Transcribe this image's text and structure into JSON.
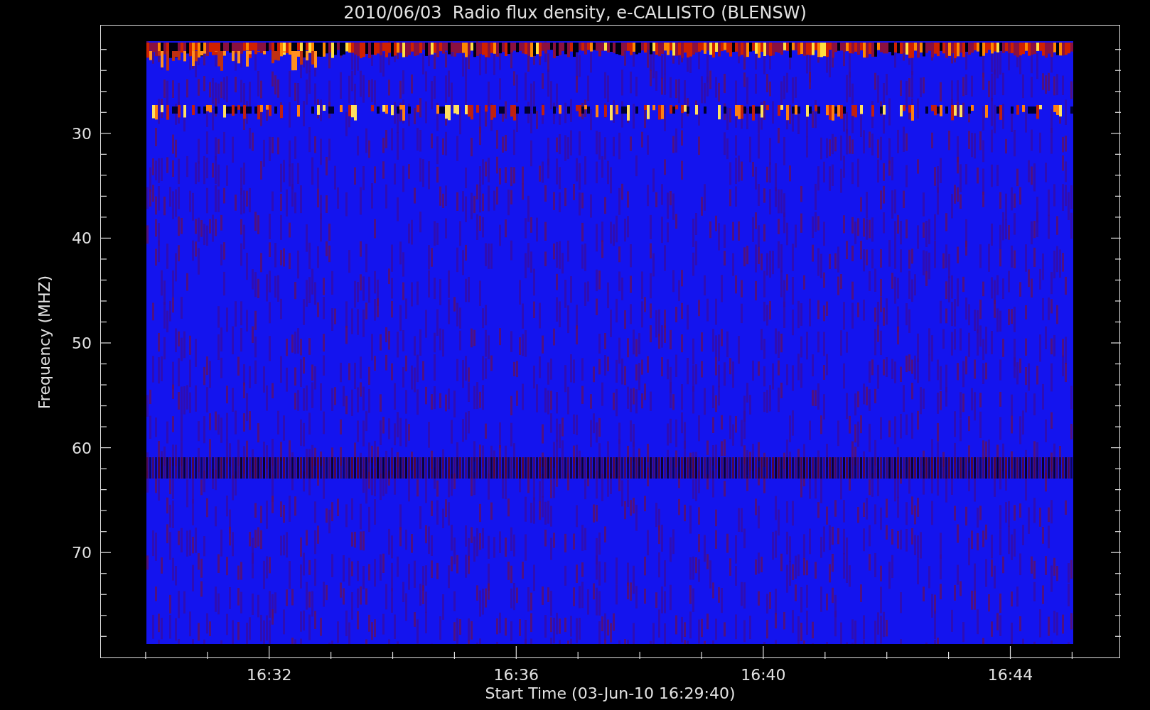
{
  "plot": {
    "title": "2010/06/03  Radio flux density, e-CALLISTO (BLENSW)",
    "xlabel": "Start Time (03-Jun-10 16:29:40)",
    "ylabel": "Frequency (MHZ)",
    "y_ticks": [
      "30",
      "40",
      "50",
      "60",
      "70"
    ],
    "x_ticks": [
      "16:32",
      "16:36",
      "16:40",
      "16:44"
    ]
  }
}
